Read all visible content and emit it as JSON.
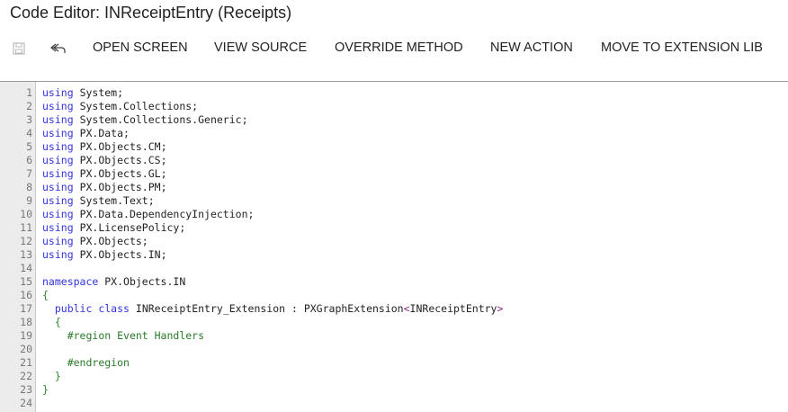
{
  "window": {
    "title": "Code Editor: INReceiptEntry (Receipts)"
  },
  "toolbar": {
    "save_icon": "save-icon",
    "undo_icon": "undo-icon",
    "open_screen": "OPEN SCREEN",
    "view_source": "VIEW SOURCE",
    "override_method": "OVERRIDE METHOD",
    "new_action": "NEW ACTION",
    "move_to_extension_lib": "MOVE TO EXTENSION LIB"
  },
  "colors": {
    "keyword": "#3333dd",
    "brace": "#2a8a2a",
    "preprocessor": "#2a7a2a"
  },
  "code": [
    {
      "n": "1",
      "parts": [
        [
          "kw",
          "using"
        ],
        [
          "",
          "System;"
        ]
      ]
    },
    {
      "n": "2",
      "parts": [
        [
          "kw",
          "using"
        ],
        [
          "",
          "System.Collections;"
        ]
      ]
    },
    {
      "n": "3",
      "parts": [
        [
          "kw",
          "using"
        ],
        [
          "",
          "System.Collections.Generic;"
        ]
      ]
    },
    {
      "n": "4",
      "parts": [
        [
          "kw",
          "using"
        ],
        [
          "",
          "PX.Data;"
        ]
      ]
    },
    {
      "n": "5",
      "parts": [
        [
          "kw",
          "using"
        ],
        [
          "",
          "PX.Objects.CM;"
        ]
      ]
    },
    {
      "n": "6",
      "parts": [
        [
          "kw",
          "using"
        ],
        [
          "",
          "PX.Objects.CS;"
        ]
      ]
    },
    {
      "n": "7",
      "parts": [
        [
          "kw",
          "using"
        ],
        [
          "",
          "PX.Objects.GL;"
        ]
      ]
    },
    {
      "n": "8",
      "parts": [
        [
          "kw",
          "using"
        ],
        [
          "",
          "PX.Objects.PM;"
        ]
      ]
    },
    {
      "n": "9",
      "parts": [
        [
          "kw",
          "using"
        ],
        [
          "",
          "System.Text;"
        ]
      ]
    },
    {
      "n": "10",
      "parts": [
        [
          "kw",
          "using"
        ],
        [
          "",
          "PX.Data.DependencyInjection;"
        ]
      ]
    },
    {
      "n": "11",
      "parts": [
        [
          "kw",
          "using"
        ],
        [
          "",
          "PX.LicensePolicy;"
        ]
      ]
    },
    {
      "n": "12",
      "parts": [
        [
          "kw",
          "using"
        ],
        [
          "",
          "PX.Objects;"
        ]
      ]
    },
    {
      "n": "13",
      "parts": [
        [
          "kw",
          "using"
        ],
        [
          "",
          "PX.Objects.IN;"
        ]
      ]
    },
    {
      "n": "14",
      "parts": []
    },
    {
      "n": "15",
      "parts": [
        [
          "kw",
          "namespace"
        ],
        [
          "",
          "PX.Objects.IN"
        ]
      ]
    },
    {
      "n": "16",
      "parts": [
        [
          "br",
          "{"
        ]
      ]
    },
    {
      "n": "17",
      "parts": [
        [
          "",
          "  "
        ],
        [
          "kw",
          "public class"
        ],
        [
          "",
          "INReceiptEntry_Extension : PXGraphExtension"
        ],
        [
          "ang",
          "<"
        ],
        [
          "",
          "INReceiptEntry"
        ],
        [
          "ang",
          ">"
        ]
      ]
    },
    {
      "n": "18",
      "parts": [
        [
          "",
          "  "
        ],
        [
          "br",
          "{"
        ]
      ]
    },
    {
      "n": "19",
      "parts": [
        [
          "",
          "    "
        ],
        [
          "pp",
          "#region Event Handlers"
        ]
      ]
    },
    {
      "n": "20",
      "parts": []
    },
    {
      "n": "21",
      "parts": [
        [
          "",
          "    "
        ],
        [
          "pp",
          "#endregion"
        ]
      ]
    },
    {
      "n": "22",
      "parts": [
        [
          "",
          "  "
        ],
        [
          "br",
          "}"
        ]
      ]
    },
    {
      "n": "23",
      "parts": [
        [
          "br",
          "}"
        ]
      ]
    },
    {
      "n": "24",
      "parts": []
    }
  ]
}
